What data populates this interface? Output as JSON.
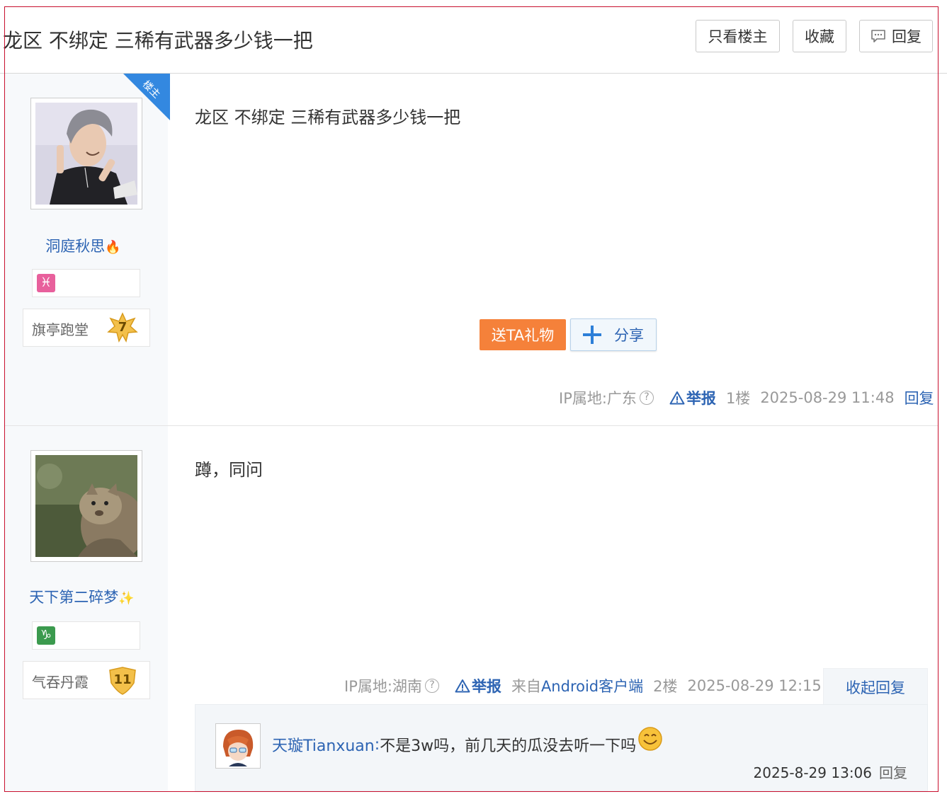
{
  "thread": {
    "title": "龙区 不绑定 三稀有武器多少钱一把",
    "buttons": {
      "only_op": "只看楼主",
      "favorite": "收藏",
      "reply": "回复"
    }
  },
  "posts": [
    {
      "op_badge": "楼主",
      "user": {
        "name": "洞庭秋思",
        "badge_icon": "flame-icon",
        "zodiac": "♓",
        "zodiac_color": "#e8609c",
        "level_name": "旗亭跑堂",
        "level": "7"
      },
      "content": "龙区 不绑定 三稀有武器多少钱一把",
      "actions": {
        "gift": "送TA礼物",
        "share": "分享"
      },
      "tail": {
        "ip": "IP属地:广东",
        "help": "?",
        "report": "举报",
        "floor": "1楼",
        "date": "2025-08-29 11:48",
        "reply": "回复"
      }
    },
    {
      "user": {
        "name": "天下第二碎梦",
        "badge_icon": "sparkle-icon",
        "zodiac": "♑",
        "zodiac_color": "#3b9a4e",
        "level_name": "气吞丹霞",
        "level": "11"
      },
      "content": "蹲，同问",
      "tail": {
        "ip": "IP属地:湖南",
        "help": "?",
        "report": "举报",
        "source_prefix": "来自",
        "source": "Android客户端",
        "floor": "2楼",
        "date": "2025-08-29 12:15"
      },
      "collapse": "收起回复",
      "sub_replies": [
        {
          "user": "天璇Tianxuan",
          "sep": ":",
          "text": " 不是3w吗，前几天的瓜没去听一下吗",
          "date": "2025-8-29 13:06",
          "reply": "回复"
        }
      ]
    }
  ]
}
